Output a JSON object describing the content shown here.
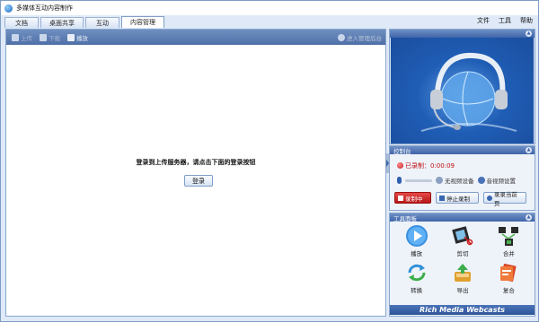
{
  "window": {
    "title": "多媒体互动内容制作"
  },
  "menubar": {
    "items": [
      "文件",
      "工具",
      "帮助"
    ]
  },
  "tabs": [
    {
      "label": "文档",
      "active": false
    },
    {
      "label": "桌面共享",
      "active": false
    },
    {
      "label": "互动",
      "active": false
    },
    {
      "label": "内容管理",
      "active": true
    }
  ],
  "toolbar": {
    "items": [
      {
        "label": "上传",
        "icon": "upload-icon",
        "enabled": false
      },
      {
        "label": "下载",
        "icon": "download-icon",
        "enabled": false
      },
      {
        "label": "播放",
        "icon": "play-icon",
        "enabled": true
      }
    ],
    "right_label": "进入管理后台"
  },
  "content": {
    "message": "登录到上传服务器，请点击下面的登录按钮",
    "login_button": "登录"
  },
  "control_panel": {
    "title": "控制台",
    "status": "已录制：0:00:09",
    "no_video_device": "无视频设备",
    "audio_settings": "音视频设置",
    "record_button": "录制中",
    "stop_button": "停止录制",
    "record_page_button": "录录当前页"
  },
  "tools_panel": {
    "title": "工具面板",
    "tools": [
      {
        "label": "播放",
        "icon": "play-icon"
      },
      {
        "label": "剪切",
        "icon": "scissors-film-icon"
      },
      {
        "label": "合并",
        "icon": "merge-icon"
      },
      {
        "label": "转换",
        "icon": "convert-icon"
      },
      {
        "label": "导出",
        "icon": "export-icon"
      },
      {
        "label": "复合",
        "icon": "composite-icon"
      }
    ],
    "brand": "Rich Media Webcasts"
  },
  "colors": {
    "accent": "#3f65a8",
    "record": "#c81c1c",
    "window_bg": "#dfe9f7"
  }
}
